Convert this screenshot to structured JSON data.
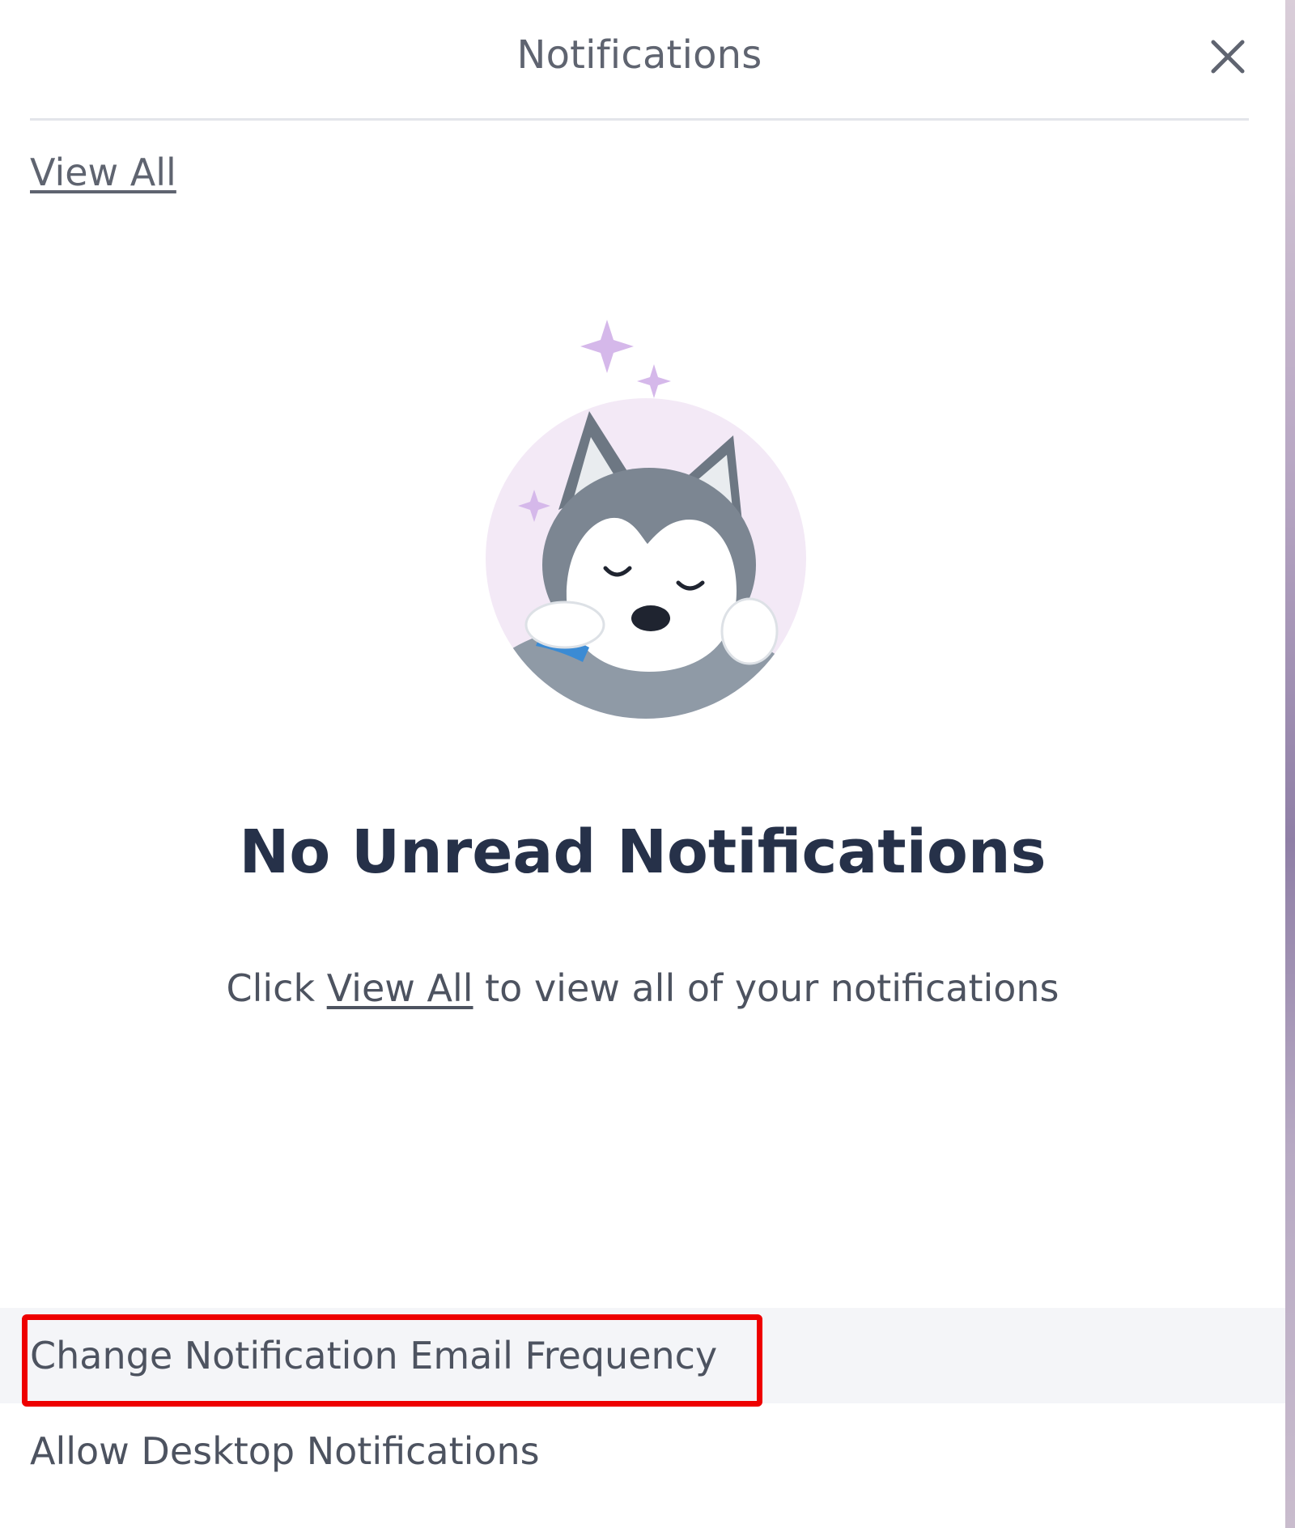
{
  "header": {
    "title": "Notifications",
    "close_icon": "close-icon"
  },
  "links": {
    "view_all": "View All"
  },
  "empty_state": {
    "illustration": "sleeping-husky-illustration",
    "title": "No Unread Notifications",
    "sub_prefix": "Click ",
    "sub_link": "View All",
    "sub_suffix": " to view all of your notifications"
  },
  "footer_menu": {
    "items": [
      {
        "label": "Change Notification Email Frequency",
        "highlighted": true
      },
      {
        "label": "Allow Desktop Notifications",
        "highlighted": false
      }
    ]
  },
  "colors": {
    "highlight_border": "#ee0000",
    "title_text": "#263149",
    "body_text": "#4d5360",
    "sparkle": "#d5b8ea",
    "moon": "#f3e9f6"
  }
}
